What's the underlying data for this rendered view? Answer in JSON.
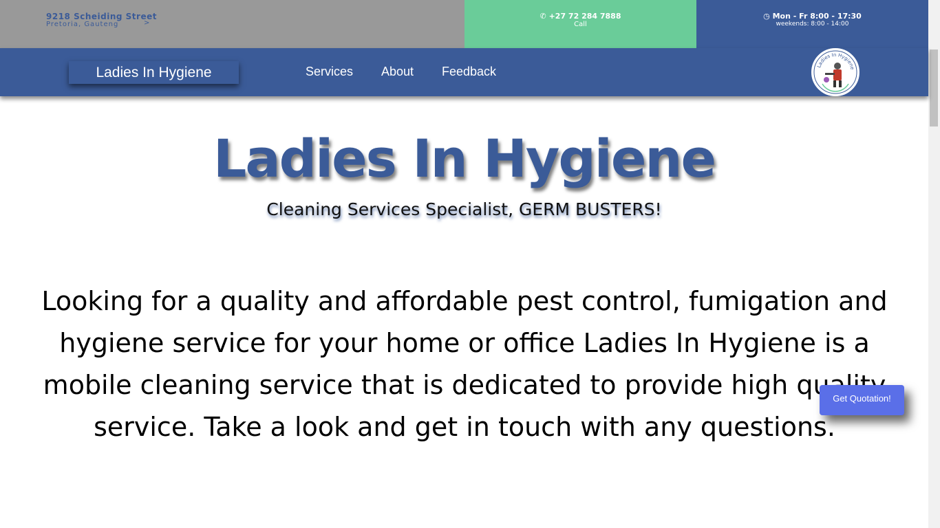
{
  "topbar": {
    "address_street": "9218 Scheiding Street",
    "address_city": "Pretoria, Gauteng",
    "address_chevron": ">",
    "phone_icon": "phone-icon",
    "phone_number": "+27 72 284 7888",
    "phone_label": "Call",
    "hours_icon": "clock-icon",
    "hours_main": "Mon - Fr 8:00 - 17:30",
    "hours_sub": "weekends: 8:00 - 14:00"
  },
  "navbar": {
    "brand": "Ladies In Hygiene",
    "links": [
      "Services",
      "About",
      "Feedback"
    ],
    "logo_text": "Ladies In Hygiene",
    "logo_icon": "pest-control-technician-logo"
  },
  "hero": {
    "title": "Ladies In Hygiene",
    "subtitle": "Cleaning Services Specialist, GERM BUSTERS!",
    "intro": "Looking for a quality and affordable pest control, fumigation and hygiene service for your home or office Ladies In Hygiene is a mobile cleaning service that is dedicated to provide high quality service. Take a look and get in touch with any questions."
  },
  "quote_button": "Get Quotation!",
  "colors": {
    "brand_blue": "#3b5b98",
    "green": "#6acc99",
    "grey": "#999999",
    "button_blue": "#5a6fe8"
  }
}
